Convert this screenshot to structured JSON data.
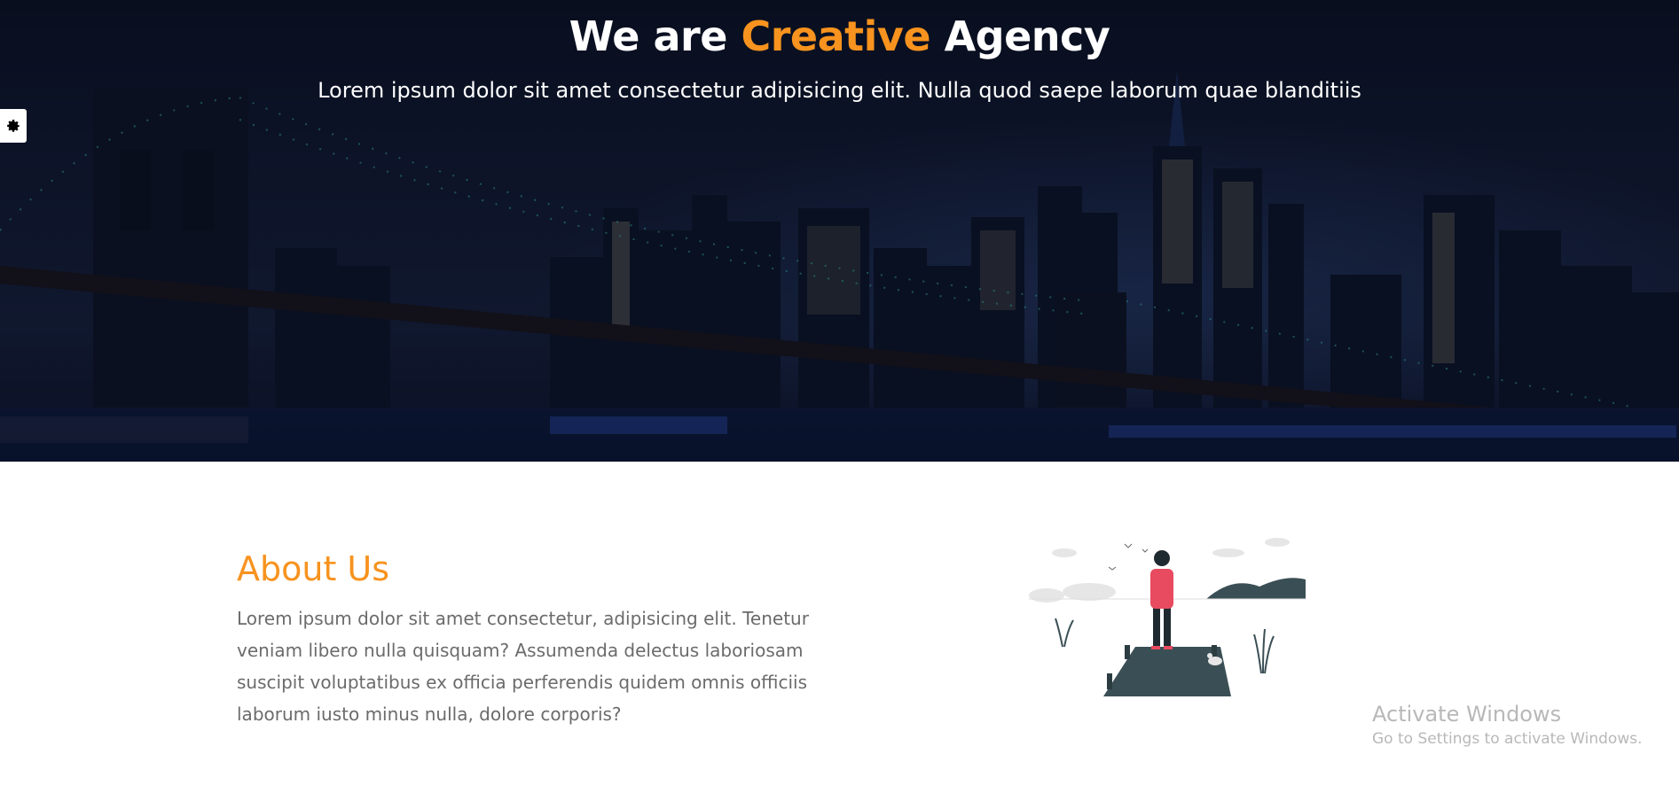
{
  "hero": {
    "title_prefix": "We are ",
    "title_accent": "Creative",
    "title_suffix": " Agency",
    "subtitle": "Lorem ipsum dolor sit amet consectetur adipisicing elit. Nulla quod saepe laborum quae blanditiis"
  },
  "settings": {
    "icon": "gear-icon"
  },
  "about": {
    "title": "About Us",
    "text": "Lorem ipsum dolor sit amet consectetur, adipisicing elit. Tenetur veniam libero nulla quisquam? Assumenda delectus laboriosam suscipit voluptatibus ex officia perferendis quidem omnis officiis laborum iusto minus nulla, dolore corporis?"
  },
  "watermark": {
    "title": "Activate Windows",
    "subtitle": "Go to Settings to activate Windows."
  },
  "colors": {
    "accent": "#f7931e",
    "hero_bg": "#111a30",
    "text_muted": "#6b6b6b"
  }
}
